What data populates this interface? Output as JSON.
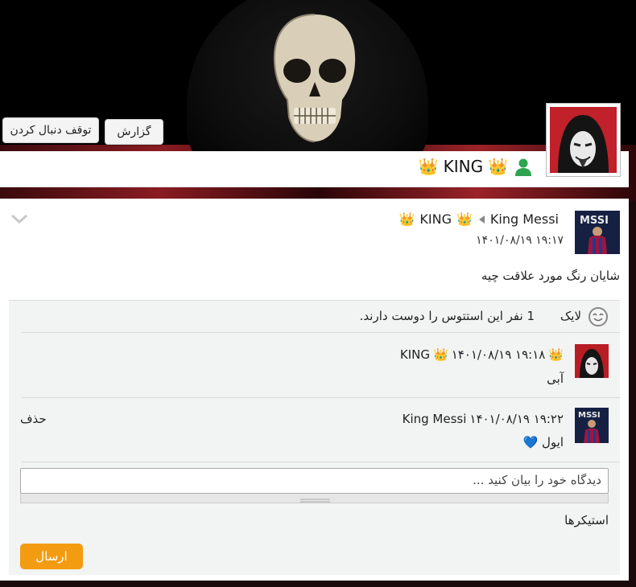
{
  "header": {
    "report_button": "گزارش",
    "unfollow_button": "توقف دنبال کردن",
    "profile_name": "KING",
    "crown_glyph": "👑"
  },
  "status": {
    "author": "King Messi",
    "target": "KING",
    "timestamp": "۱۴۰۱/۰۸/۱۹ ۱۹:۱۷",
    "text": "شایان رنگ مورد علاقت چیه"
  },
  "likes": {
    "like_label": "لایک",
    "summary": "1 نفر این استتوس را دوست دارند."
  },
  "comments": [
    {
      "author": "KING",
      "timestamp": "۱۴۰۱/۰۸/۱۹ ۱۹:۱۸",
      "text": "آبی"
    },
    {
      "author": "King Messi",
      "timestamp": "۱۴۰۱/۰۸/۱۹ ۱۹:۲۲",
      "text": "ایول 💙",
      "delete_label": "حذف"
    }
  ],
  "composer": {
    "placeholder": "دیدگاه خود را بیان کنید ...",
    "stickers_label": "استیکرها",
    "send_button": "ارسال"
  },
  "colors": {
    "accent": "#f39c12",
    "crown": "#f0b400",
    "profile_icon": "#2ea44f"
  }
}
